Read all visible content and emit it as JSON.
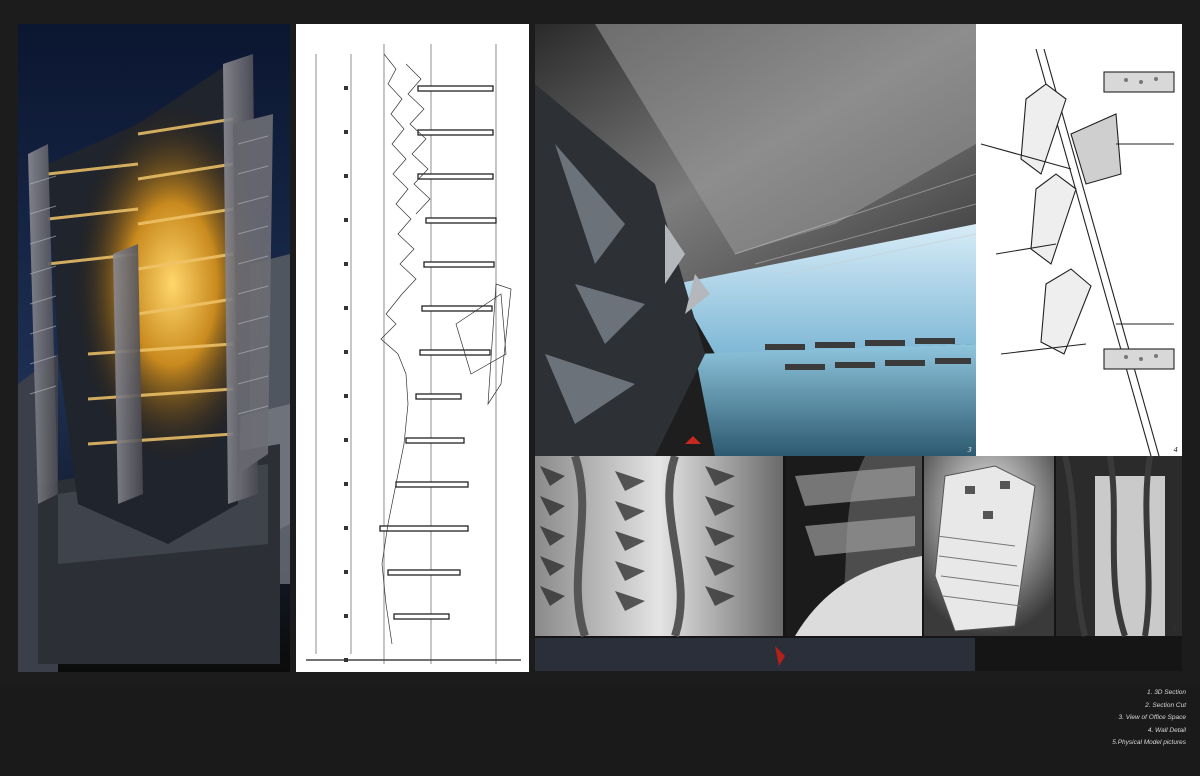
{
  "panels": {
    "p1": {
      "number": "1"
    },
    "p2": {
      "number": "2"
    },
    "p3": {
      "number": "3"
    },
    "p4": {
      "number": "4"
    },
    "p5": {
      "number": "5"
    }
  },
  "captions": [
    "1. 3D Section",
    "2. Section Cut",
    "3. View of Office Space",
    "4. Wall Detail",
    "5.Physical Model pictures"
  ],
  "colors": {
    "background": "#1c1c1c",
    "glow": "#e8a524",
    "paper": "#ffffff"
  }
}
